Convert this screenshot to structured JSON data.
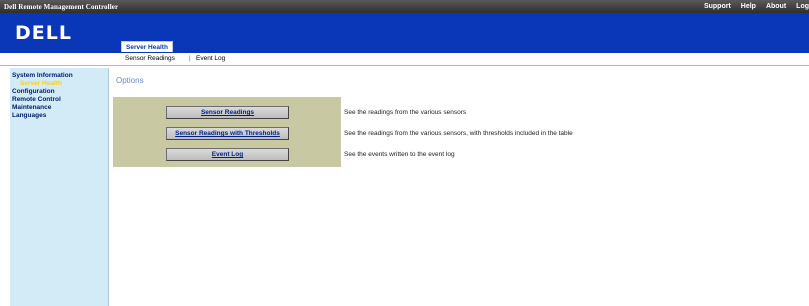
{
  "titlebar": {
    "app_title": "Dell Remote Management Controller",
    "links": [
      "Support",
      "Help",
      "About",
      "Log"
    ]
  },
  "header": {
    "logo": "DELL",
    "active_tab": "Server Health",
    "brand_color": "#0a36b8"
  },
  "subnav": {
    "items": [
      "Sensor Readings",
      "Event Log"
    ],
    "separator": "|"
  },
  "sidebar": {
    "items": [
      {
        "label": "System Information",
        "type": "section"
      },
      {
        "label": "Server Health",
        "type": "active"
      },
      {
        "label": "Configuration",
        "type": "section"
      },
      {
        "label": "Remote Control",
        "type": "section"
      },
      {
        "label": "Maintenance",
        "type": "section"
      },
      {
        "label": "Languages",
        "type": "section"
      }
    ]
  },
  "main": {
    "title": "Options",
    "options": [
      {
        "button": "Sensor Readings",
        "description": "See the readings from the various sensors"
      },
      {
        "button": "Sensor Readings with Thresholds",
        "description": "See the readings from the various sensors, with thresholds included in the table"
      },
      {
        "button": "Event Log",
        "description": "See the events written to the event log"
      }
    ]
  }
}
